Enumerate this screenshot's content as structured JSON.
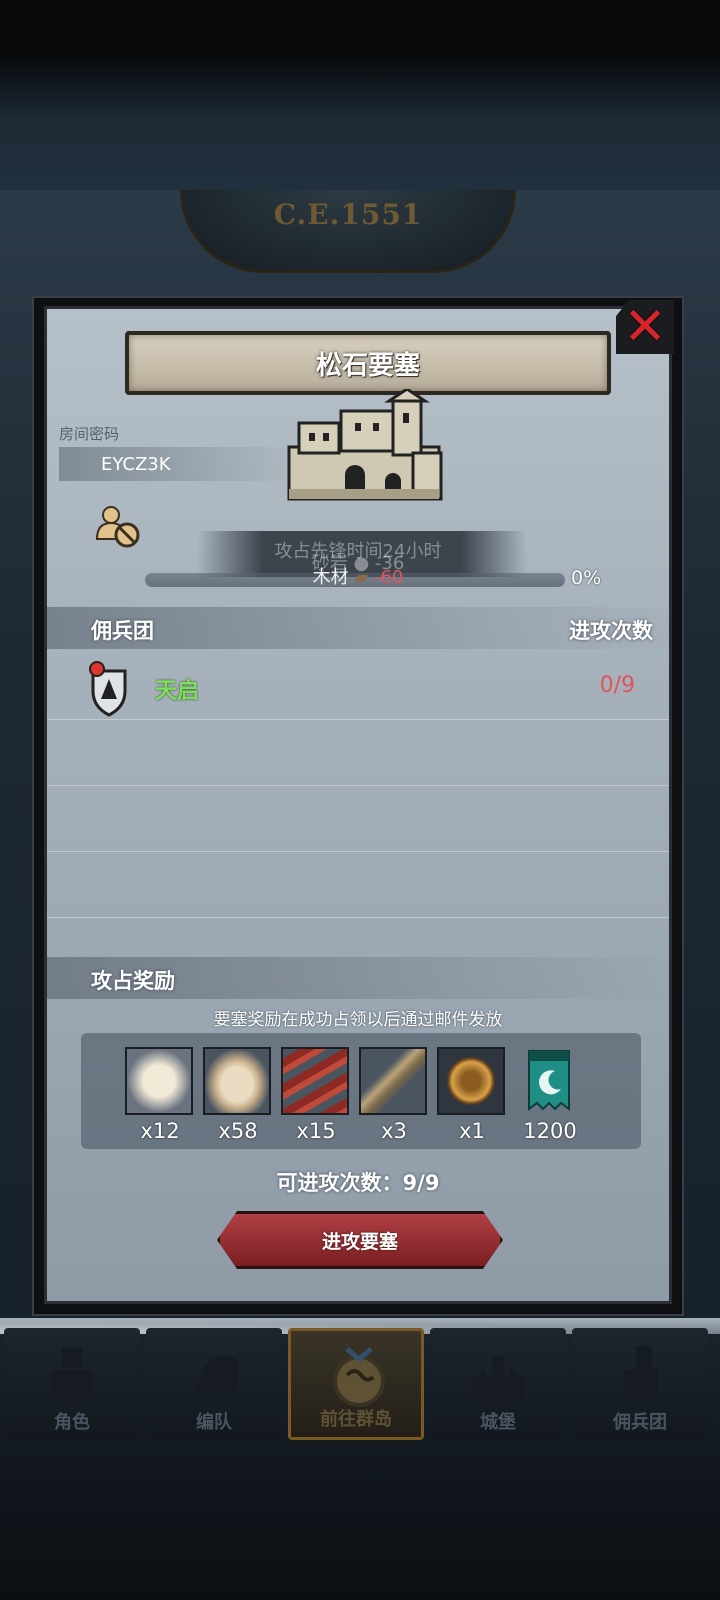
{
  "header": {
    "year": "C.E.1551"
  },
  "modal": {
    "title": "松石要塞",
    "room": {
      "label": "房间密码",
      "code": "EYCZ3K"
    },
    "overlap_texts": {
      "attack_time": "攻占先锋时间24小时",
      "sandstone": "砂岩",
      "sandstone_value": "-36"
    },
    "resource": {
      "label": "木材",
      "value": "-60"
    },
    "progress": {
      "percent_text": "0%",
      "value": 0
    },
    "mercenary_section": {
      "title": "佣兵团",
      "attack_count_header": "进攻次数"
    },
    "mercenaries": [
      {
        "name": "天启",
        "attacks": "0/9"
      }
    ],
    "reward_section": {
      "title": "攻占奖励",
      "note": "要塞奖励在成功占领以后通过邮件发放"
    },
    "rewards": [
      {
        "icon": "fur-pelt-icon",
        "qty": "x12"
      },
      {
        "icon": "raw-hide-icon",
        "qty": "x58"
      },
      {
        "icon": "red-wood-planks-icon",
        "qty": "x15"
      },
      {
        "icon": "spiral-horn-icon",
        "qty": "x3"
      },
      {
        "icon": "knight-helmet-coin-icon",
        "qty": "x1"
      },
      {
        "icon": "guild-banner-icon",
        "qty": "1200"
      }
    ],
    "attempts_text": "可进攻次数：9/9",
    "attack_button": "进攻要塞"
  },
  "nav": {
    "tabs": [
      {
        "label": "角色",
        "icon": "knight-armor-icon"
      },
      {
        "label": "编队",
        "icon": "helmet-formation-icon"
      },
      {
        "label": "前往群岛",
        "icon": "globe-compass-icon",
        "active": true
      },
      {
        "label": "城堡",
        "icon": "castle-icon"
      },
      {
        "label": "佣兵团",
        "icon": "mercenary-icon"
      }
    ]
  },
  "colors": {
    "accent_red": "#e0555a",
    "accent_green": "#7ee05a",
    "close_red": "#d8242a",
    "button_red": "#9a2e33"
  }
}
